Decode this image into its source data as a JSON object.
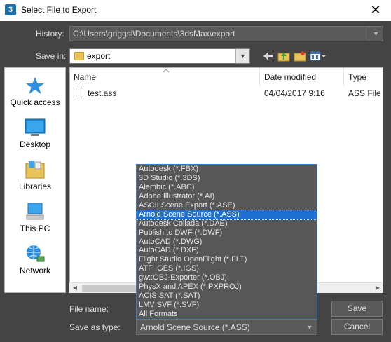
{
  "window": {
    "title": "Select File to Export",
    "app_icon": "3",
    "close_glyph": "✕"
  },
  "history": {
    "label": "History:",
    "value": "C:\\Users\\griggsl\\Documents\\3dsMax\\export"
  },
  "save_in": {
    "label_pre": "Save ",
    "label_key": "i",
    "label_post": "n:",
    "value": "export"
  },
  "places": [
    {
      "label": "Quick access",
      "icon": "star-icon"
    },
    {
      "label": "Desktop",
      "icon": "desktop-icon"
    },
    {
      "label": "Libraries",
      "icon": "libraries-icon"
    },
    {
      "label": "This PC",
      "icon": "computer-icon"
    },
    {
      "label": "Network",
      "icon": "network-icon"
    }
  ],
  "file_list": {
    "columns": [
      "Name",
      "Date modified",
      "Type"
    ],
    "rows": [
      {
        "name": "test.ass",
        "date": "04/04/2017 9:16",
        "type": "ASS File"
      }
    ]
  },
  "file_name": {
    "label_pre": "File ",
    "label_key": "n",
    "label_post": "ame:",
    "value": ""
  },
  "save_as_type": {
    "label_pre": "Save as ",
    "label_key": "t",
    "label_post": "ype:",
    "value": "Arnold Scene Source (*.ASS)"
  },
  "buttons": {
    "save": "Save",
    "cancel": "Cancel"
  },
  "type_options": [
    "Autodesk (*.FBX)",
    "3D Studio (*.3DS)",
    "Alembic (*.ABC)",
    "Adobe Illustrator (*.AI)",
    "ASCII Scene Export (*.ASE)",
    "Arnold Scene Source (*.ASS)",
    "Autodesk Collada (*.DAE)",
    "Publish to DWF (*.DWF)",
    "AutoCAD (*.DWG)",
    "AutoCAD (*.DXF)",
    "Flight Studio OpenFlight (*.FLT)",
    "ATF IGES (*.IGS)",
    "gw::OBJ-Exporter (*.OBJ)",
    "PhysX and APEX (*.PXPROJ)",
    "ACIS SAT (*.SAT)",
    "LMV SVF (*.SVF)",
    "All Formats"
  ],
  "selected_option": "Arnold Scene Source (*.ASS)",
  "colors": {
    "selection": "#1e6fd0",
    "dialog_bg": "#444444"
  }
}
